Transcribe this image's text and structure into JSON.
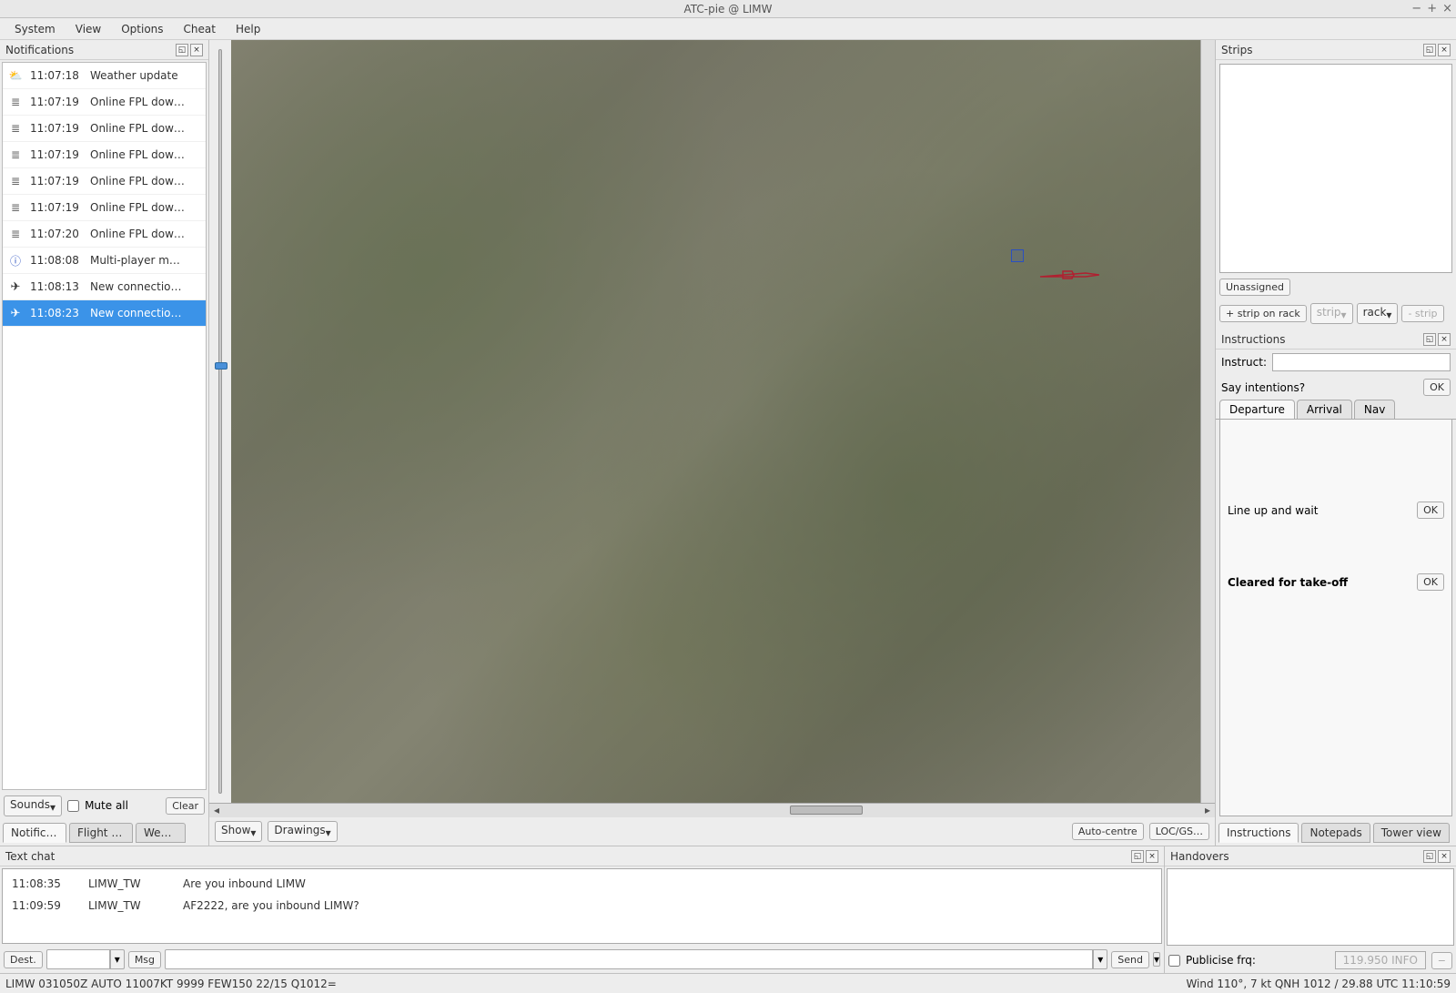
{
  "window": {
    "title": "ATC-pie @ LIMW",
    "min_tooltip": "Minimize",
    "max_tooltip": "Maximize",
    "close_tooltip": "Close"
  },
  "menu": {
    "system": "System",
    "view": "View",
    "options": "Options",
    "cheat": "Cheat",
    "help": "Help"
  },
  "left": {
    "notifications_title": "Notifications",
    "sounds_btn": "Sounds",
    "mute_all": "Mute all",
    "clear_btn": "Clear",
    "tabs": {
      "notifications": "Notificat…",
      "flightplans": "Flight p…",
      "weather": "Wea…"
    },
    "items": [
      {
        "icon": "weather",
        "time": "11:07:18",
        "msg": "Weather update"
      },
      {
        "icon": "fpl",
        "time": "11:07:19",
        "msg": "Online FPL dow…"
      },
      {
        "icon": "fpl",
        "time": "11:07:19",
        "msg": "Online FPL dow…"
      },
      {
        "icon": "fpl",
        "time": "11:07:19",
        "msg": "Online FPL dow…"
      },
      {
        "icon": "fpl",
        "time": "11:07:19",
        "msg": "Online FPL dow…"
      },
      {
        "icon": "fpl",
        "time": "11:07:19",
        "msg": "Online FPL dow…"
      },
      {
        "icon": "fpl",
        "time": "11:07:20",
        "msg": "Online FPL dow…"
      },
      {
        "icon": "info",
        "time": "11:08:08",
        "msg": "Multi-player m…"
      },
      {
        "icon": "plane",
        "time": "11:08:13",
        "msg": "New connectio…"
      },
      {
        "icon": "plane",
        "time": "11:08:23",
        "msg": "New connectio…",
        "selected": true
      }
    ]
  },
  "center": {
    "show_btn": "Show",
    "drawings_btn": "Drawings",
    "autocentre_btn": "Auto-centre",
    "locgs_btn": "LOC/GS…"
  },
  "right": {
    "strips_title": "Strips",
    "unassigned": "Unassigned",
    "add_strip": "+ strip on rack",
    "strip_btn": "strip",
    "rack_btn": "rack",
    "minus_strip": "- strip",
    "instructions_title": "Instructions",
    "instruct_label": "Instruct:",
    "say_intentions": "Say intentions?",
    "ok": "OK",
    "tabs": {
      "departure": "Departure",
      "arrival": "Arrival",
      "nav": "Nav"
    },
    "line_up": "Line up and wait",
    "cleared": "Cleared for take-off",
    "bottom_tabs": {
      "instructions": "Instructions",
      "notepads": "Notepads",
      "tower": "Tower view"
    }
  },
  "chat": {
    "title": "Text chat",
    "rows": [
      {
        "time": "11:08:35",
        "sender": "LIMW_TW",
        "msg": "Are you inbound LIMW"
      },
      {
        "time": "11:09:59",
        "sender": "LIMW_TW",
        "msg": "AF2222, are you inbound LIMW?"
      }
    ],
    "dest_btn": "Dest.",
    "msg_btn": "Msg",
    "send_btn": "Send"
  },
  "handovers": {
    "title": "Handovers",
    "publicise": "Publicise frq:",
    "freq_placeholder": "119.950  INFO"
  },
  "status": {
    "metar": "LIMW 031050Z AUTO 11007KT 9999 FEW150 22/15 Q1012=",
    "wind": "Wind 110°, 7 kt  QNH 1012 / 29.88  UTC 11:10:59"
  }
}
